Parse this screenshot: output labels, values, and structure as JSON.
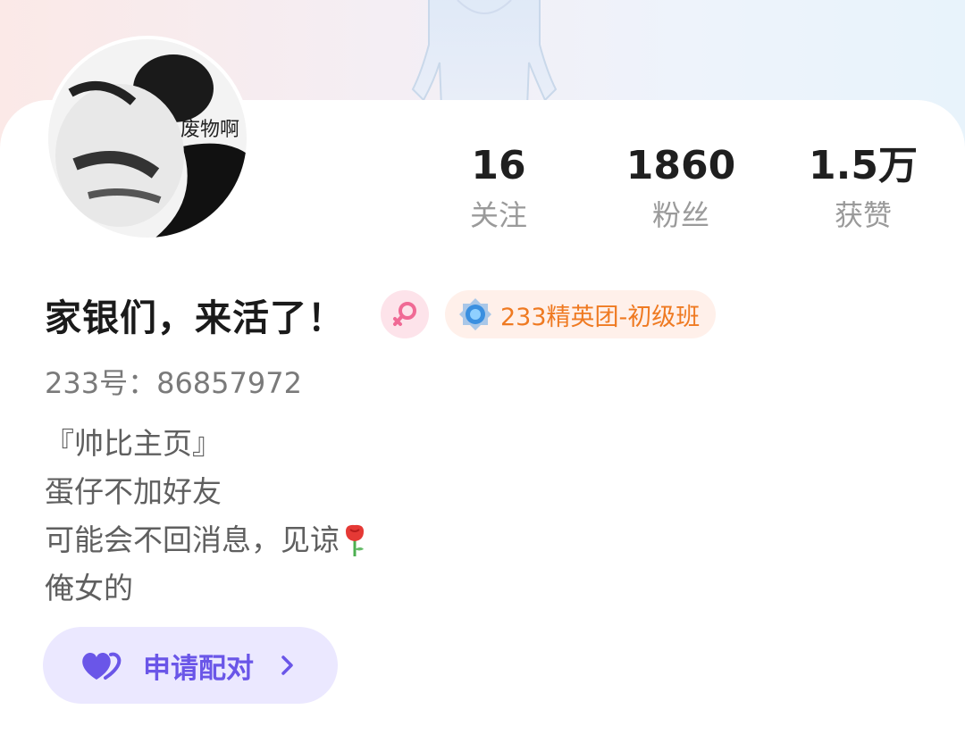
{
  "stats": [
    {
      "value": "16",
      "label": "关注"
    },
    {
      "value": "1860",
      "label": "粉丝"
    },
    {
      "value": "1.5万",
      "label": "获赞"
    }
  ],
  "profile": {
    "avatar_text": "废物啊",
    "name": "家银们，来活了！",
    "gender_icon": "female-icon",
    "badge_icon": "blue-medal-icon",
    "badge_label": "233精英团-初级班",
    "uid": "233号：86857972",
    "bio": [
      "『帅比主页』",
      "蛋仔不加好友",
      "可能会不回消息，见谅",
      "俺女的"
    ],
    "bio_emoji": "rose-icon"
  },
  "actions": {
    "pair_label": "申请配对",
    "pair_icon": "double-heart-icon",
    "pair_chevron": "chevron-right-icon"
  },
  "colors": {
    "pair_accent": "#6a56e8",
    "badge_text": "#ef7a22",
    "gender_pink": "#f06a95"
  }
}
